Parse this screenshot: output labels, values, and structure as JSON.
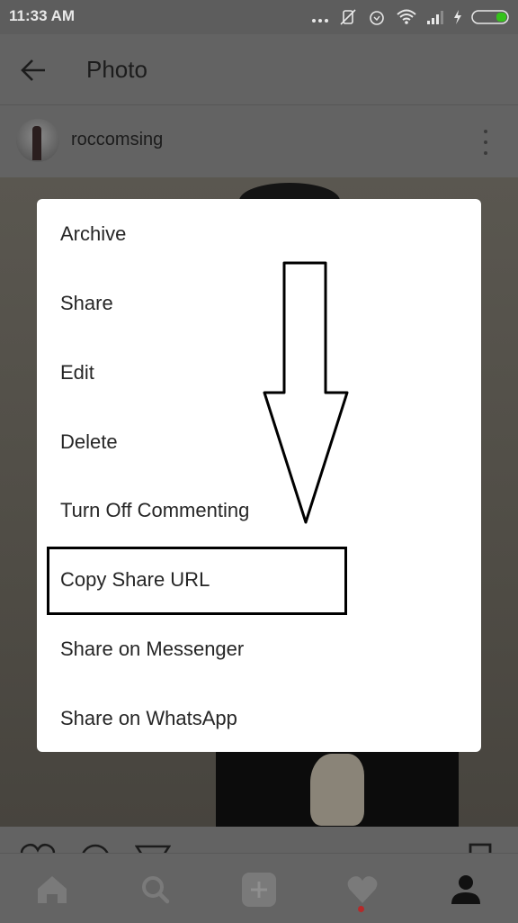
{
  "status_bar": {
    "time": "11:33 AM",
    "icons": [
      "more-notifications-icon",
      "vibrate-off-icon",
      "alarm-icon",
      "wifi-icon",
      "signal-icon",
      "charging-icon",
      "battery-icon"
    ],
    "battery_color": "#35c21b"
  },
  "app_bar": {
    "back_icon": "arrow-left-icon",
    "title": "Photo"
  },
  "post": {
    "username": "roccomsing",
    "more_icon": "vertical-ellipsis-icon"
  },
  "dialog": {
    "items": [
      {
        "label": "Archive"
      },
      {
        "label": "Share"
      },
      {
        "label": "Edit"
      },
      {
        "label": "Delete"
      },
      {
        "label": "Turn Off Commenting"
      },
      {
        "label": "Copy Share URL",
        "highlighted": true
      },
      {
        "label": "Share on Messenger"
      },
      {
        "label": "Share on WhatsApp"
      }
    ],
    "annotation": "arrow pointing down to highlighted item"
  },
  "actions": [
    "heart-icon",
    "comment-icon",
    "send-icon",
    "bookmark-icon"
  ],
  "bottom_nav": {
    "items": [
      "home-icon",
      "search-icon",
      "add-icon",
      "activity-heart-icon",
      "profile-icon"
    ],
    "active": "profile-icon",
    "notification_dot_color": "#b52a2a"
  }
}
